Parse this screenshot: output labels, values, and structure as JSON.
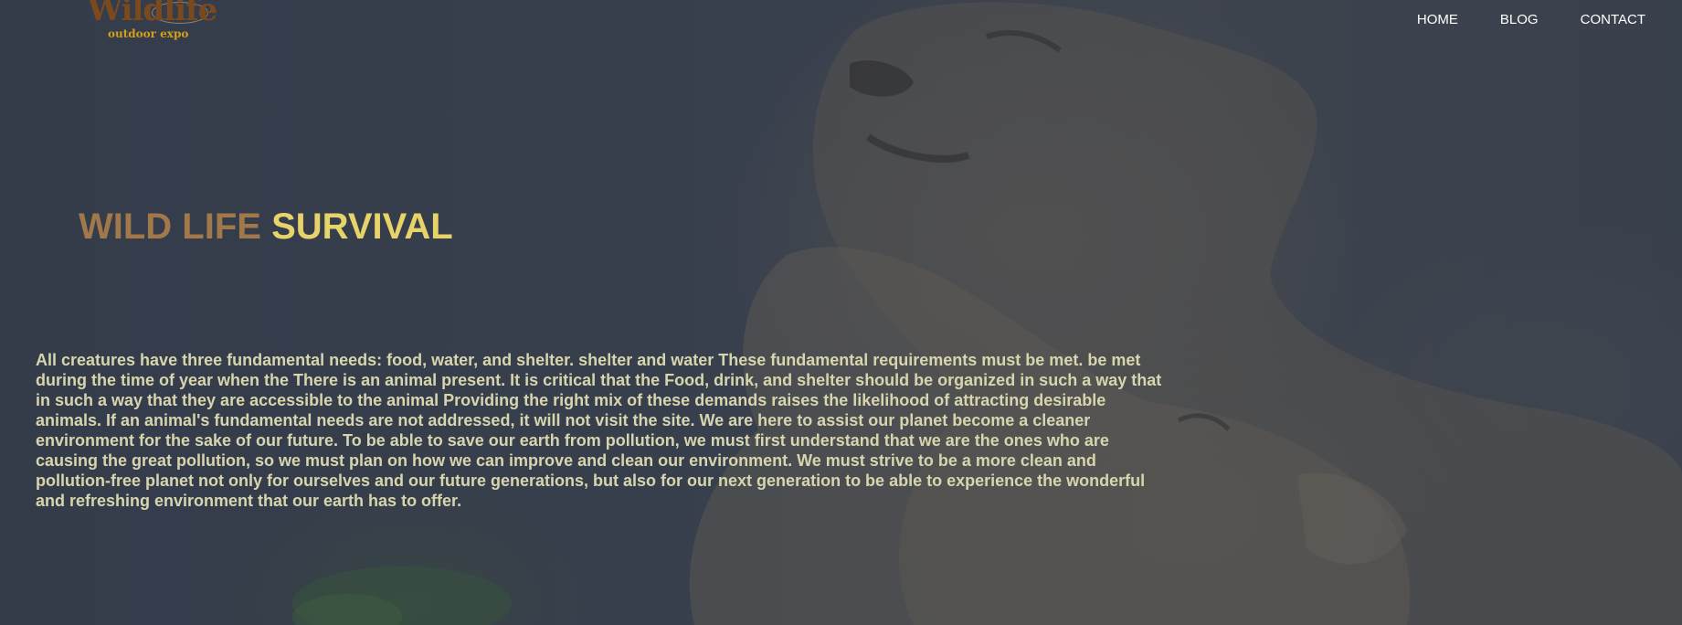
{
  "logo": {
    "title": "Wildlife",
    "subtitle": "outdoor expo"
  },
  "nav": {
    "items": [
      {
        "label": "HOME"
      },
      {
        "label": "BLOG"
      },
      {
        "label": "CONTACT"
      }
    ]
  },
  "hero": {
    "title_part1": "WILD LIFE",
    "title_part2": "SURVIVAL",
    "body": "All creatures have three fundamental needs: food, water, and shelter. shelter and water These fundamental requirements must be met. be met during the time of year when the There is an animal present. It is critical that the Food, drink, and shelter should be organized in such a way that in such a way that they are accessible to the animal Providing the right mix of these demands raises the likelihood of attracting desirable animals. If an animal's fundamental needs are not addressed, it will not visit the site. We are here to assist our planet become a cleaner environment for the sake of our future. To be able to save our earth from pollution, we must first understand that we are the ones who are causing the great pollution, so we must plan on how we can improve and clean our environment. We must strive to be a more clean and pollution-free planet not only for ourselves and our future generations, but also for our next generation to be able to experience the wonderful and refreshing environment that our earth has to offer."
  },
  "colors": {
    "title_part1": "#a0784a",
    "title_part2": "#e6d36a",
    "body_text": "#d7d5ae",
    "nav_text": "#ffffff",
    "background": "#3c4350"
  }
}
